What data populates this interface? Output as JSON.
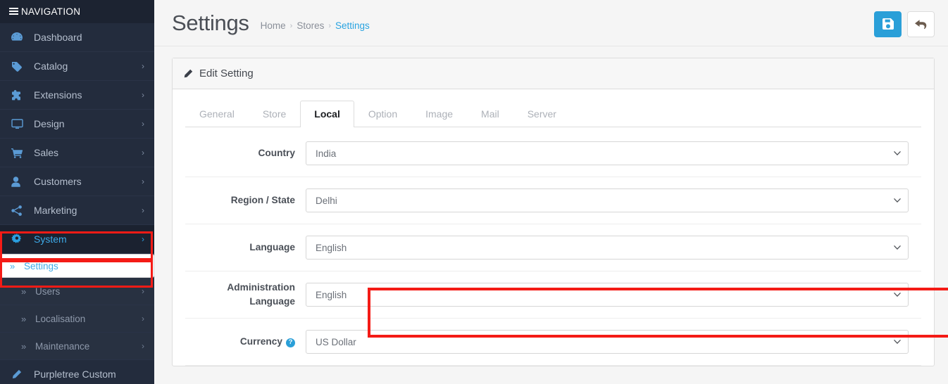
{
  "sidebar": {
    "header_label": "NAVIGATION",
    "items": [
      {
        "label": "Dashboard",
        "icon": "dashboard-icon",
        "caret": "",
        "active": false
      },
      {
        "label": "Catalog",
        "icon": "tag-icon",
        "caret": "›",
        "active": false
      },
      {
        "label": "Extensions",
        "icon": "puzzle-icon",
        "caret": "›",
        "active": false
      },
      {
        "label": "Design",
        "icon": "monitor-icon",
        "caret": "›",
        "active": false
      },
      {
        "label": "Sales",
        "icon": "cart-icon",
        "caret": "›",
        "active": false
      },
      {
        "label": "Customers",
        "icon": "user-icon",
        "caret": "›",
        "active": false
      },
      {
        "label": "Marketing",
        "icon": "share-icon",
        "caret": "›",
        "active": false
      },
      {
        "label": "System",
        "icon": "gear-icon",
        "caret": "›",
        "active": true
      }
    ],
    "subitems": [
      {
        "label": "Settings",
        "chevron": "»",
        "caret": "",
        "selected": true
      },
      {
        "label": "Users",
        "chevron": "»",
        "caret": "›",
        "selected": false
      },
      {
        "label": "Localisation",
        "chevron": "»",
        "caret": "›",
        "selected": false
      },
      {
        "label": "Maintenance",
        "chevron": "»",
        "caret": "›",
        "selected": false
      }
    ],
    "footer_item": {
      "label": "Purpletree Custom",
      "icon": "pencil-icon"
    }
  },
  "header": {
    "title": "Settings",
    "breadcrumb": [
      {
        "label": "Home",
        "current": false
      },
      {
        "label": "Stores",
        "current": false
      },
      {
        "label": "Settings",
        "current": true
      }
    ],
    "separator": "›",
    "save_button_title": "Save",
    "back_button_title": "Back"
  },
  "panel": {
    "title": "Edit Setting",
    "tabs": [
      {
        "label": "General",
        "active": false
      },
      {
        "label": "Store",
        "active": false
      },
      {
        "label": "Local",
        "active": true
      },
      {
        "label": "Option",
        "active": false
      },
      {
        "label": "Image",
        "active": false
      },
      {
        "label": "Mail",
        "active": false
      },
      {
        "label": "Server",
        "active": false
      }
    ],
    "fields": [
      {
        "label": "Country",
        "value": "India",
        "help": false,
        "highlighted": false
      },
      {
        "label": "Region / State",
        "value": "Delhi",
        "help": false,
        "highlighted": false
      },
      {
        "label": "Language",
        "value": "English",
        "help": false,
        "highlighted": false
      },
      {
        "label": "Administration Language",
        "value": "English",
        "help": false,
        "highlighted": true
      },
      {
        "label": "Currency",
        "value": "US Dollar",
        "help": true,
        "highlighted": false
      }
    ],
    "select_chevron": "⌄",
    "help_glyph": "?"
  },
  "colors": {
    "sidebar_bg": "#232c3d",
    "sidebar_header_bg": "#1c2331",
    "accent_blue": "#2a9fd8",
    "link_blue": "#29a3e0",
    "highlight_red": "#f41b16",
    "page_bg": "#f5f5f5",
    "panel_bg": "#ffffff"
  }
}
